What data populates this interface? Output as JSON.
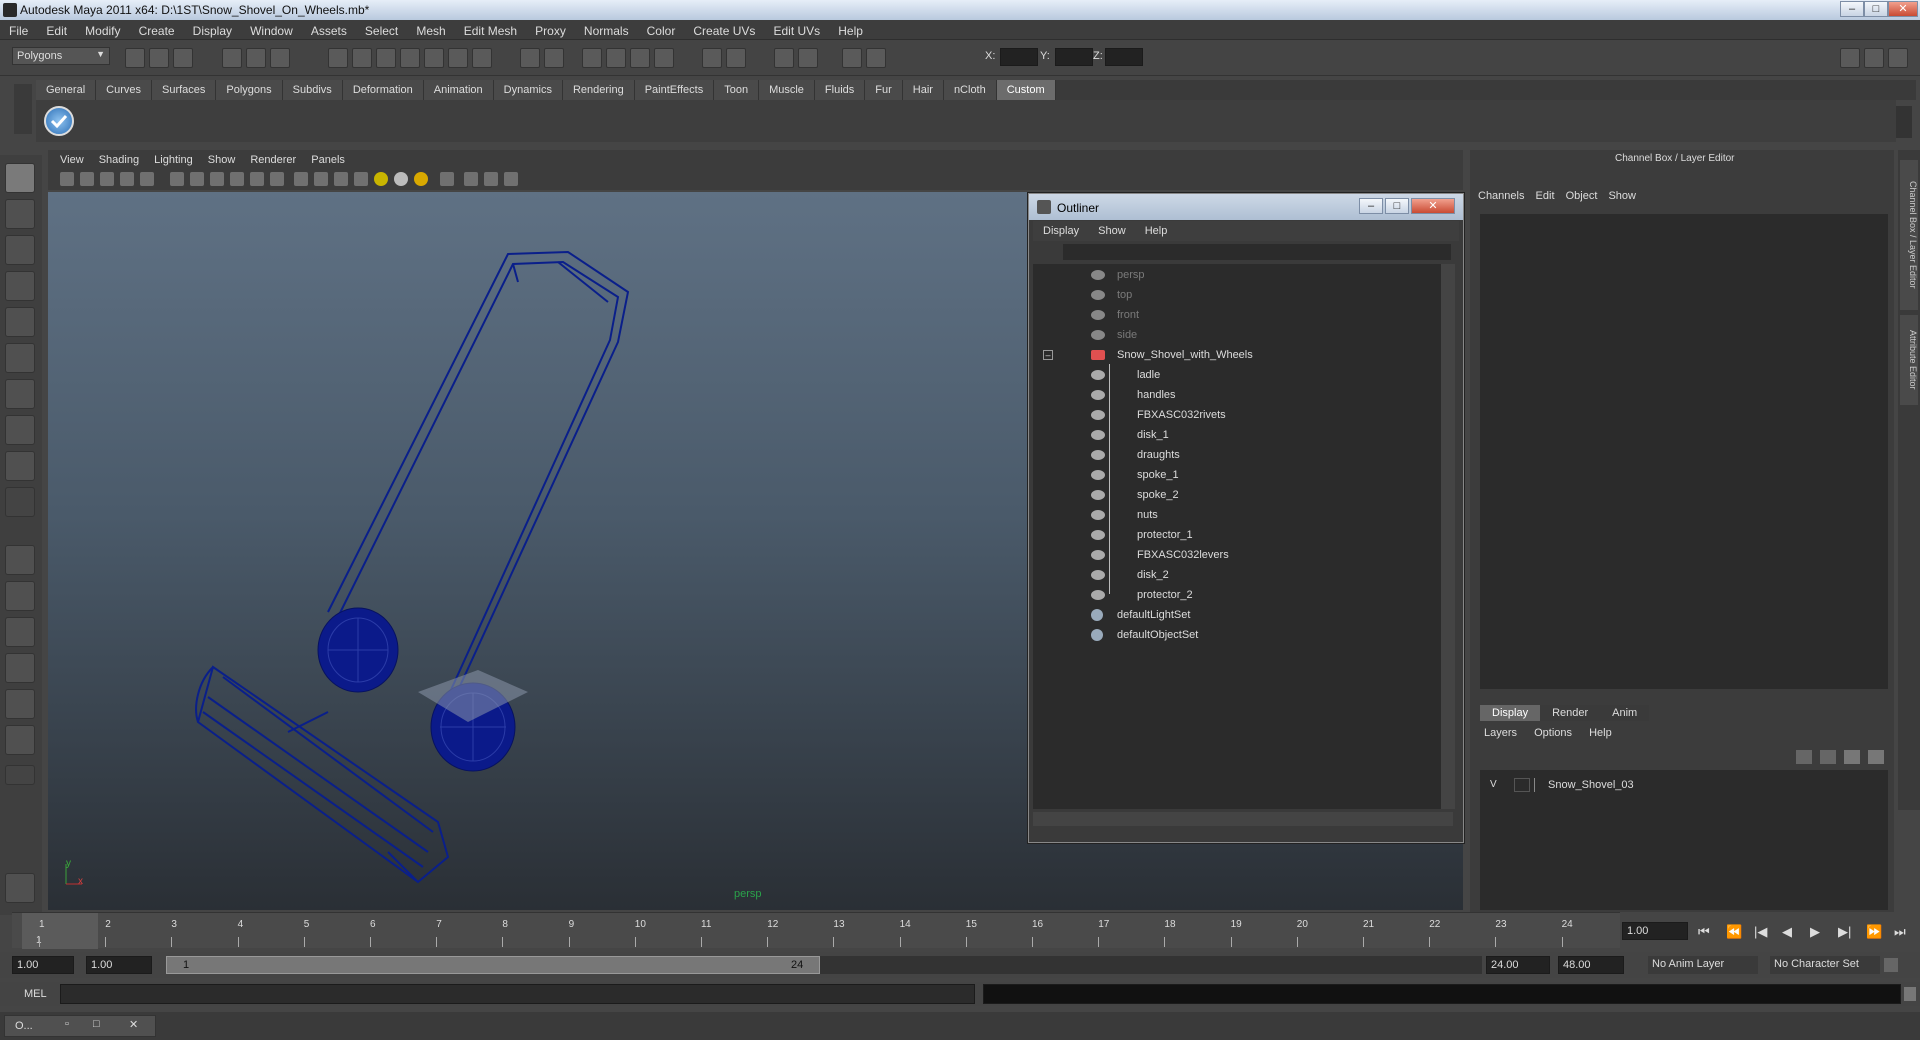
{
  "window": {
    "title": "Autodesk Maya 2011 x64: D:\\1ST\\Snow_Shovel_On_Wheels.mb*"
  },
  "menubar": [
    "File",
    "Edit",
    "Modify",
    "Create",
    "Display",
    "Window",
    "Assets",
    "Select",
    "Mesh",
    "Edit Mesh",
    "Proxy",
    "Normals",
    "Color",
    "Create UVs",
    "Edit UVs",
    "Help"
  ],
  "status": {
    "mode": "Polygons",
    "x_label": "X:",
    "y_label": "Y:",
    "z_label": "Z:"
  },
  "shelf_tabs": [
    "General",
    "Curves",
    "Surfaces",
    "Polygons",
    "Subdivs",
    "Deformation",
    "Animation",
    "Dynamics",
    "Rendering",
    "PaintEffects",
    "Toon",
    "Muscle",
    "Fluids",
    "Fur",
    "Hair",
    "nCloth",
    "Custom"
  ],
  "active_shelf_tab": "Custom",
  "viewport": {
    "menus": [
      "View",
      "Shading",
      "Lighting",
      "Show",
      "Renderer",
      "Panels"
    ],
    "camera_label": "persp",
    "axis_x": "x",
    "axis_y": "y"
  },
  "outliner": {
    "title": "Outliner",
    "menus": [
      "Display",
      "Show",
      "Help"
    ],
    "cameras": [
      "persp",
      "top",
      "front",
      "side"
    ],
    "root": "Snow_Shovel_with_Wheels",
    "children": [
      "ladle",
      "handles",
      "FBXASC032rivets",
      "disk_1",
      "draughts",
      "spoke_1",
      "spoke_2",
      "nuts",
      "protector_1",
      "FBXASC032levers",
      "disk_2",
      "protector_2"
    ],
    "sets": [
      "defaultLightSet",
      "defaultObjectSet"
    ]
  },
  "channel_box": {
    "header": "Channel Box / Layer Editor",
    "menus": [
      "Channels",
      "Edit",
      "Object",
      "Show"
    ],
    "layer_tabs": [
      "Display",
      "Render",
      "Anim"
    ],
    "active_layer_tab": "Display",
    "layer_menus": [
      "Layers",
      "Options",
      "Help"
    ],
    "layer": {
      "visible": "V",
      "name": "Snow_Shovel_03"
    }
  },
  "side_tabs": [
    "Channel Box / Layer Editor",
    "Attribute Editor"
  ],
  "timeline": {
    "ticks": [
      "1",
      "2",
      "3",
      "4",
      "5",
      "6",
      "7",
      "8",
      "9",
      "10",
      "11",
      "12",
      "13",
      "14",
      "15",
      "16",
      "17",
      "18",
      "19",
      "20",
      "21",
      "22",
      "23",
      "24"
    ],
    "current_frame_label": "1",
    "current_time": "1.00"
  },
  "range": {
    "start": "1.00",
    "playback_start": "1.00",
    "slider_start": "1",
    "slider_end": "24",
    "playback_end": "24.00",
    "end": "48.00",
    "anim_layer": "No Anim Layer",
    "character_set": "No Character Set"
  },
  "command": {
    "label": "MEL"
  },
  "taskbar": {
    "item": "O..."
  }
}
